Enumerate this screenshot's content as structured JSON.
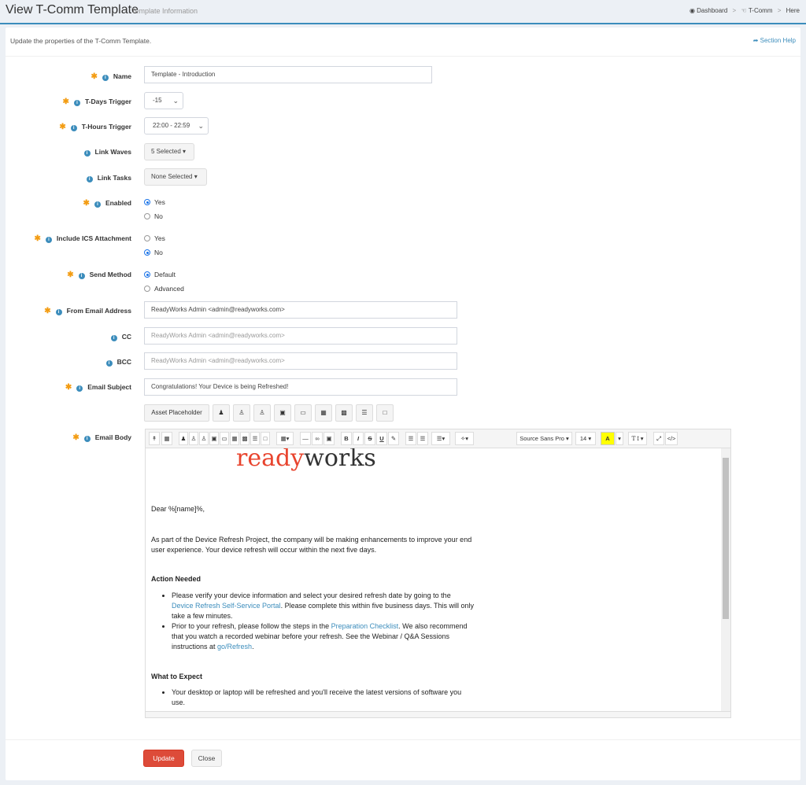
{
  "header": {
    "title": "View T-Comm Template",
    "subtitle": "Template Information",
    "breadcrumbs": [
      "Dashboard",
      "T-Comm",
      "Here"
    ]
  },
  "box": {
    "description": "Update the properties of the T-Comm Template.",
    "section_help": "Section Help"
  },
  "form": {
    "name_label": "Name",
    "name_value": "Template - Introduction",
    "tdays_label": "T-Days Trigger",
    "tdays_value": "-15",
    "thours_label": "T-Hours Trigger",
    "thours_value": "22:00 - 22:59",
    "waves_label": "Link Waves",
    "waves_value": "5 Selected",
    "tasks_label": "Link Tasks",
    "tasks_value": "None Selected",
    "enabled_label": "Enabled",
    "enabled_options": [
      "Yes",
      "No"
    ],
    "ics_label": "Include ICS Attachment",
    "ics_options": [
      "Yes",
      "No"
    ],
    "send_label": "Send Method",
    "send_options": [
      "Default",
      "Advanced"
    ],
    "from_label": "From Email Address",
    "from_value": "ReadyWorks Admin <admin@readyworks.com>",
    "cc_label": "CC",
    "cc_placeholder": "ReadyWorks Admin <admin@readyworks.com>",
    "bcc_label": "BCC",
    "bcc_placeholder": "ReadyWorks Admin <admin@readyworks.com>",
    "subject_label": "Email Subject",
    "subject_value": "Congratulations! Your Device is being Refreshed!",
    "asset_placeholder": "Asset Placeholder",
    "body_label": "Email Body"
  },
  "editor": {
    "font_name": "Source Sans Pro",
    "font_size": "14",
    "logo_ready": "ready",
    "logo_works": "works",
    "greeting": "Dear %[name]%,",
    "intro": "As part of the Device Refresh Project, the company will be making enhancements to improve your end user experience. Your device refresh will occur within the next five days.",
    "action_heading": "Action Needed",
    "bullet1_pre": "Please verify your device information and select your desired refresh date by going to the ",
    "bullet1_link": "Device Refresh Self-Service Portal",
    "bullet1_post": ". Please complete this within five business days. This will only take a few minutes.",
    "bullet2_pre": "Prior to your refresh, please follow the steps in the ",
    "bullet2_link": "Preparation Checklist",
    "bullet2_mid": ". We also recommend that you watch a recorded webinar before your refresh. See the Webinar / Q&A Sessions instructions at ",
    "bullet2_link2": "go/Refresh",
    "bullet2_post": ".",
    "expect_heading": "What to Expect",
    "bullet3": "Your desktop or laptop will be refreshed and you'll receive the latest versions of software you use."
  },
  "footer": {
    "update_label": "Update",
    "close_label": "Close"
  },
  "colors": {
    "accent": "#3c8dbc",
    "required": "#f39c12",
    "danger": "#dd4b39",
    "logo_red": "#e8442e"
  }
}
